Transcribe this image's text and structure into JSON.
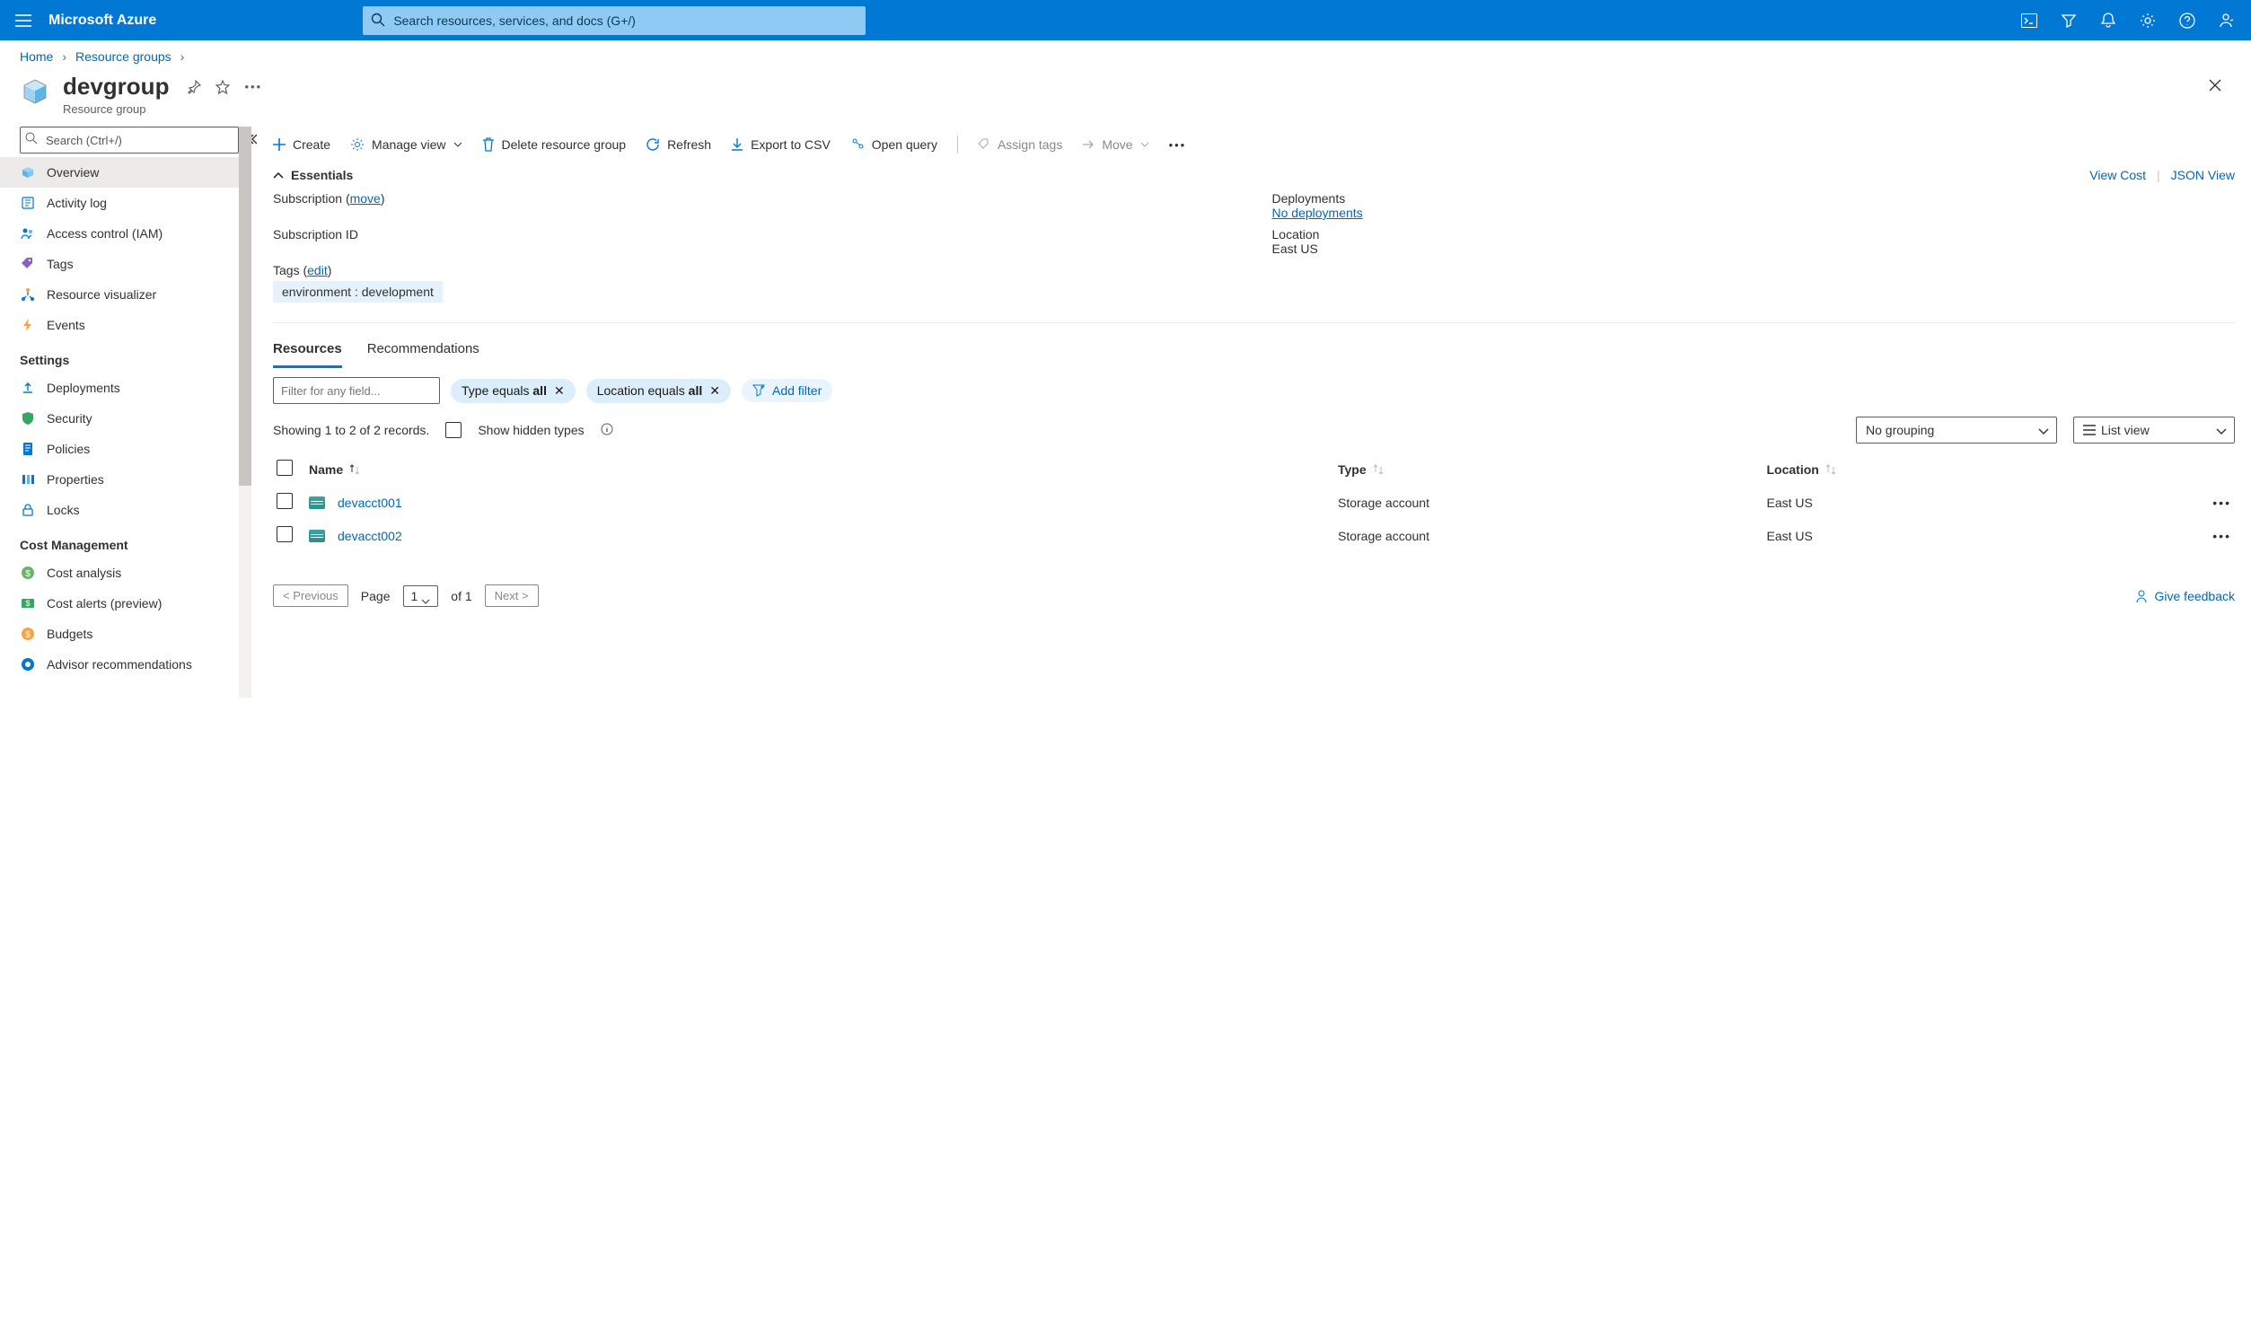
{
  "brand": "Microsoft Azure",
  "search_placeholder": "Search resources, services, and docs (G+/)",
  "breadcrumb": {
    "home": "Home",
    "rg": "Resource groups"
  },
  "title": "devgroup",
  "subtitle": "Resource group",
  "close_label": "✕",
  "sidebar": {
    "search_placeholder": "Search (Ctrl+/)",
    "items_top": [
      {
        "label": "Overview"
      },
      {
        "label": "Activity log"
      },
      {
        "label": "Access control (IAM)"
      },
      {
        "label": "Tags"
      },
      {
        "label": "Resource visualizer"
      },
      {
        "label": "Events"
      }
    ],
    "group_settings": "Settings",
    "items_settings": [
      {
        "label": "Deployments"
      },
      {
        "label": "Security"
      },
      {
        "label": "Policies"
      },
      {
        "label": "Properties"
      },
      {
        "label": "Locks"
      }
    ],
    "group_cost": "Cost Management",
    "items_cost": [
      {
        "label": "Cost analysis"
      },
      {
        "label": "Cost alerts (preview)"
      },
      {
        "label": "Budgets"
      },
      {
        "label": "Advisor recommendations"
      }
    ]
  },
  "toolbar": {
    "create": "Create",
    "manage_view": "Manage view",
    "delete_rg": "Delete resource group",
    "refresh": "Refresh",
    "export_csv": "Export to CSV",
    "open_query": "Open query",
    "assign_tags": "Assign tags",
    "move": "Move"
  },
  "essentials": {
    "header": "Essentials",
    "view_cost": "View Cost",
    "json_view": "JSON View",
    "subscription_label": "Subscription",
    "subscription_move": "move",
    "subscription_id_label": "Subscription ID",
    "deployments_label": "Deployments",
    "deployments_value": "No deployments",
    "location_label": "Location",
    "location_value": "East US",
    "tags_label": "Tags",
    "tags_edit": "edit",
    "tag_chip": "environment : development"
  },
  "tabs": {
    "resources": "Resources",
    "recommendations": "Recommendations"
  },
  "filters": {
    "field_placeholder": "Filter for any field...",
    "type_prefix": "Type equals ",
    "type_value": "all",
    "location_prefix": "Location equals ",
    "location_value": "all",
    "add_filter": "Add filter"
  },
  "results": {
    "showing": "Showing 1 to 2 of 2 records.",
    "show_hidden": "Show hidden types",
    "no_grouping": "No grouping",
    "list_view": "List view"
  },
  "columns": {
    "name": "Name",
    "type": "Type",
    "location": "Location"
  },
  "rows": [
    {
      "name": "devacct001",
      "type": "Storage account",
      "location": "East US"
    },
    {
      "name": "devacct002",
      "type": "Storage account",
      "location": "East US"
    }
  ],
  "pager": {
    "prev": "< Previous",
    "page_label": "Page",
    "page_value": "1",
    "of_label": "of 1",
    "next": "Next >"
  },
  "feedback": "Give feedback"
}
